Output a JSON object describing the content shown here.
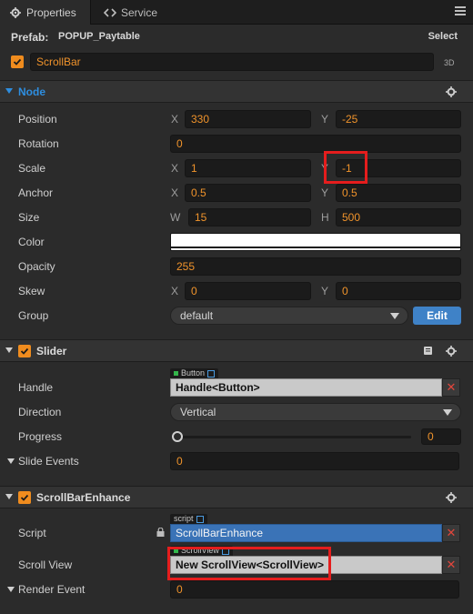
{
  "tabs": [
    {
      "label": "Properties",
      "icon": "gear-icon",
      "active": true
    },
    {
      "label": "Service",
      "icon": "service-icon",
      "active": false
    }
  ],
  "prefab": {
    "label": "Prefab:",
    "name": "POPUP_Paytable",
    "select_label": "Select"
  },
  "node": {
    "enabled": true,
    "name": "ScrollBar",
    "mode_label": "3D"
  },
  "node_section": {
    "title": "Node",
    "position": {
      "label": "Position",
      "x_label": "X",
      "x": "330",
      "y_label": "Y",
      "y": "-25"
    },
    "rotation": {
      "label": "Rotation",
      "value": "0"
    },
    "scale": {
      "label": "Scale",
      "x_label": "X",
      "x": "1",
      "y_label": "Y",
      "y": "-1"
    },
    "anchor": {
      "label": "Anchor",
      "x_label": "X",
      "x": "0.5",
      "y_label": "Y",
      "y": "0.5"
    },
    "size": {
      "label": "Size",
      "w_label": "W",
      "w": "15",
      "h_label": "H",
      "h": "500"
    },
    "color": {
      "label": "Color",
      "value": "#ffffff"
    },
    "opacity": {
      "label": "Opacity",
      "value": "255"
    },
    "skew": {
      "label": "Skew",
      "x_label": "X",
      "x": "0",
      "y_label": "Y",
      "y": "0"
    },
    "group": {
      "label": "Group",
      "value": "default",
      "edit_label": "Edit"
    }
  },
  "slider_section": {
    "title": "Slider",
    "enabled": true,
    "handle": {
      "label": "Handle",
      "tag": "Button",
      "value": "Handle<Button>"
    },
    "direction": {
      "label": "Direction",
      "value": "Vertical"
    },
    "progress": {
      "label": "Progress",
      "value": "0",
      "fraction": 0
    },
    "slide_events": {
      "label": "Slide Events",
      "value": "0"
    }
  },
  "scrollbar_enhance_section": {
    "title": "ScrollBarEnhance",
    "enabled": true,
    "script": {
      "label": "Script",
      "tag": "script",
      "value": "ScrollBarEnhance"
    },
    "scroll_view": {
      "label": "Scroll View",
      "tag": "ScrollView",
      "value": "New ScrollView<ScrollView>"
    },
    "render_event": {
      "label": "Render Event",
      "value": "0"
    }
  },
  "colors": {
    "accent": "#f08c1e",
    "value_text": "#f0932b",
    "edit_button": "#3f82c7",
    "script_field": "#3a73b7",
    "highlight": "#e51d1d",
    "clear_x": "#e2463c"
  }
}
